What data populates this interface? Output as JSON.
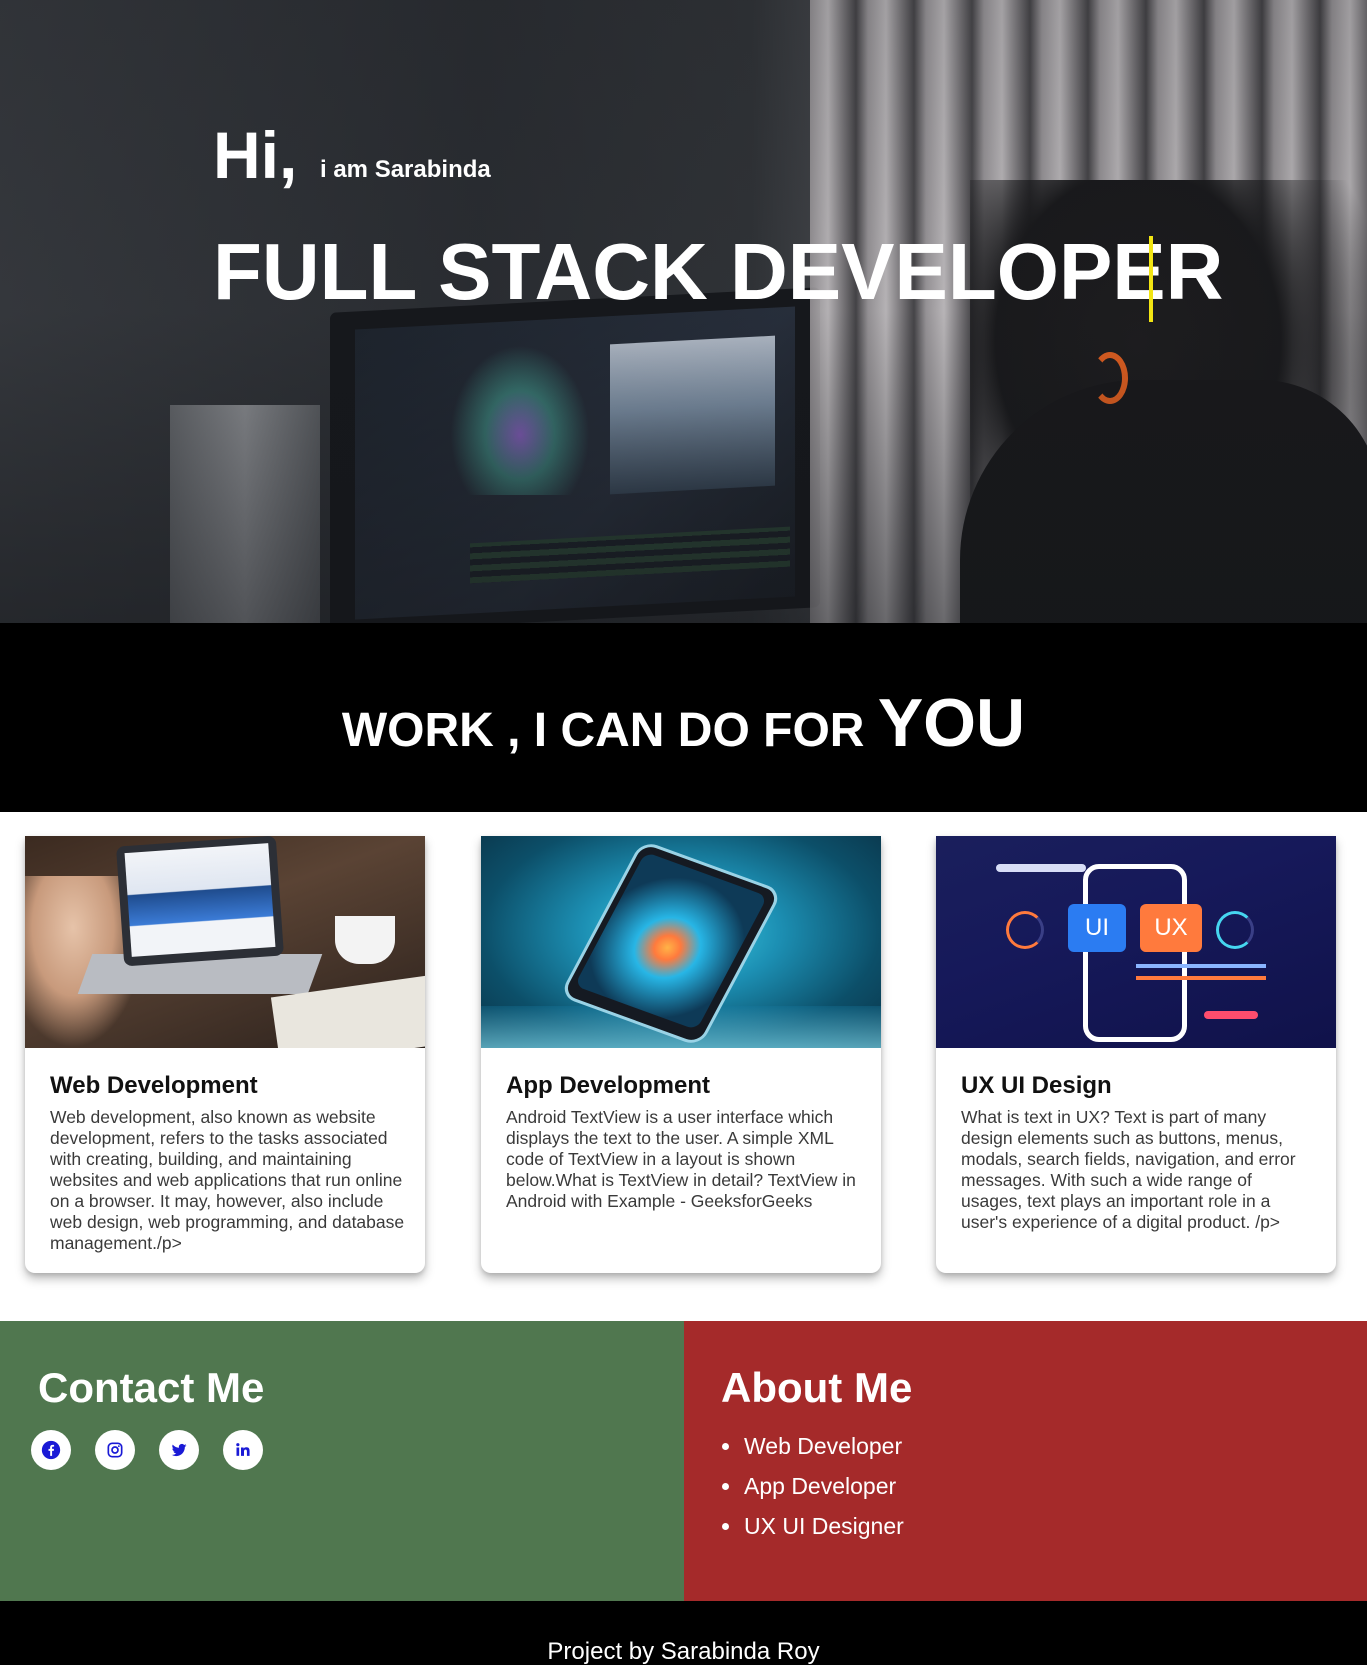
{
  "hero": {
    "greeting": "Hi,",
    "intro": "i am Sarabinda",
    "headline": "FULL STACK DEVELOPER"
  },
  "work": {
    "heading_main": "WORK , I CAN DO FOR",
    "heading_emphasis": "YOU"
  },
  "cards": [
    {
      "title": "Web Development",
      "text": "Web development, also known as website development, refers to the tasks associated with creating, building, and maintaining websites and web applications that run online on a browser. It may, however, also include web design, web programming, and database management./p>"
    },
    {
      "title": "App Development",
      "text": "Android TextView is a user interface which displays the text to the user. A simple XML code of TextView in a layout is shown below.What is TextView in detail? TextView in Android with Example - GeeksforGeeks"
    },
    {
      "title": "UX UI Design",
      "text": "What is text in UX? Text is part of many design elements such as buttons, menus, modals, search fields, navigation, and error messages. With such a wide range of usages, text plays an important role in a user's experience of a digital product. /p>",
      "image_labels": {
        "ui": "UI",
        "ux": "UX"
      }
    }
  ],
  "contact": {
    "title": "Contact Me",
    "icons": [
      "facebook-icon",
      "instagram-icon",
      "twitter-icon",
      "linkedin-icon"
    ]
  },
  "about": {
    "title": "About Me",
    "items": [
      "Web Developer",
      "App Developer",
      "UX UI Designer"
    ]
  },
  "footer": {
    "text": "Project by Sarabinda Roy"
  },
  "colors": {
    "contact_bg": "#50774f",
    "about_bg": "#a52a2a",
    "cursor": "#f2e513",
    "icon_color": "#1a1ad6"
  }
}
